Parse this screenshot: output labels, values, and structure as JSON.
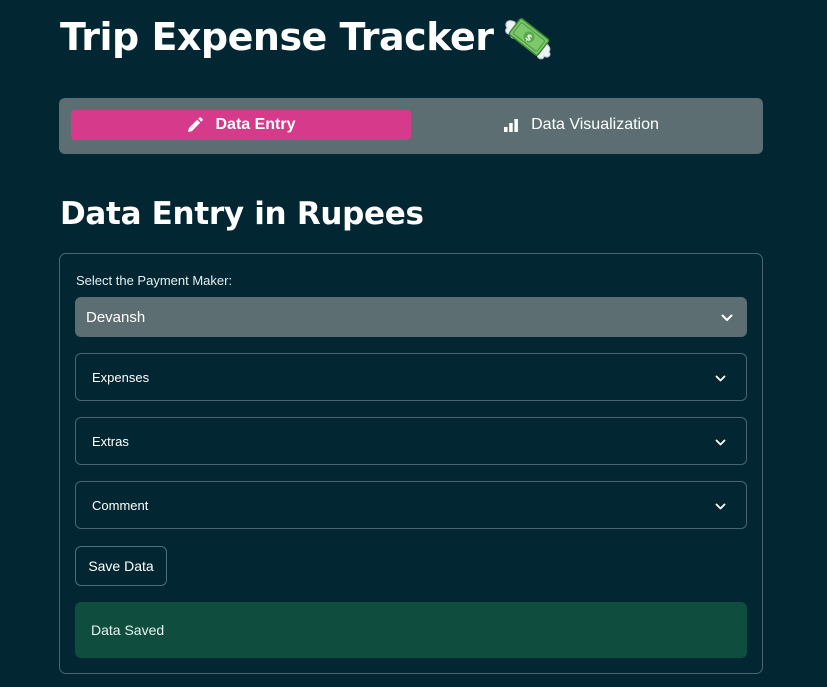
{
  "app": {
    "title": "Trip Expense Tracker",
    "title_icon": "money-with-wings-icon"
  },
  "tabs": [
    {
      "label": "Data Entry",
      "icon": "pencil-icon",
      "active": true
    },
    {
      "label": "Data Visualization",
      "icon": "bar-chart-icon",
      "active": false
    }
  ],
  "section": {
    "title": "Data Entry in Rupees"
  },
  "form": {
    "payment_label": "Select the Payment Maker:",
    "payment_value": "Devansh",
    "expanders": [
      {
        "label": "Expenses"
      },
      {
        "label": "Extras"
      },
      {
        "label": "Comment"
      }
    ],
    "save_label": "Save Data",
    "success_message": "Data Saved"
  },
  "colors": {
    "background": "#022733",
    "accent_tab": "#d63a8a",
    "tabbar": "#5d6e72",
    "success": "#0f4d3e"
  }
}
